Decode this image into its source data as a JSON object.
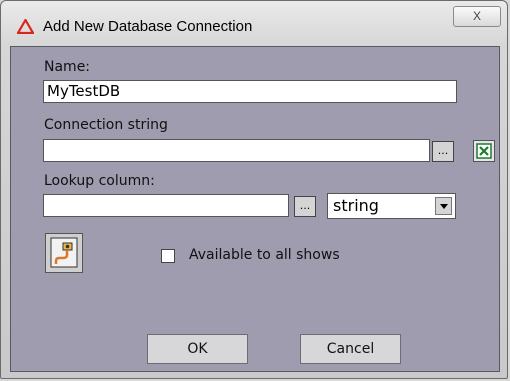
{
  "window": {
    "title": "Add New Database Connection",
    "close_glyph": "X"
  },
  "form": {
    "name_label": "Name:",
    "name_value": "MyTestDB",
    "connection_label": "Connection string",
    "connection_value": "",
    "browse_glyph": "...",
    "excel_icon": "excel-icon",
    "lookup_label": "Lookup column:",
    "lookup_value": "",
    "lookup_browse_glyph": "...",
    "type_selected": "string",
    "available_label": "Available to all shows",
    "available_checked": false
  },
  "buttons": {
    "ok": "OK",
    "cancel": "Cancel"
  },
  "colors": {
    "client_bg": "#9e9cae",
    "accent_red": "#d9261c",
    "excel_green": "#1f7a2e"
  }
}
